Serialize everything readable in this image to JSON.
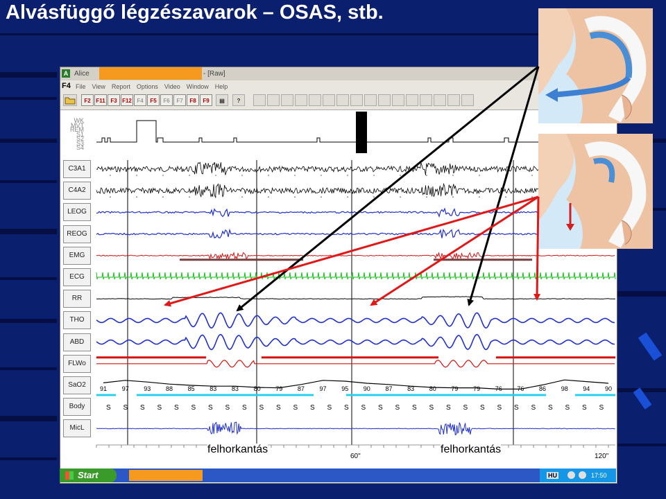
{
  "slide": {
    "title": "Alvásfüggő légzészavarok – OSAS, stb."
  },
  "window": {
    "app_name": "Alice",
    "mode": "- [Raw]",
    "f4_label": "F4",
    "menu": [
      "File",
      "View",
      "Report",
      "Options",
      "Video",
      "Window",
      "Help"
    ],
    "toolbar_keys": [
      {
        "label": "F2",
        "active": true
      },
      {
        "label": "F11",
        "active": true
      },
      {
        "label": "F3",
        "active": true
      },
      {
        "label": "F12",
        "active": true
      },
      {
        "label": "F4",
        "active": false
      },
      {
        "label": "F5",
        "active": true
      },
      {
        "label": "F6",
        "active": false
      },
      {
        "label": "F7",
        "active": false
      },
      {
        "label": "F8",
        "active": true
      },
      {
        "label": "F9",
        "active": true
      }
    ]
  },
  "hypnogram": {
    "stages": [
      "WK",
      "MVT",
      "REM",
      "S1",
      "S2",
      "S3",
      "S4"
    ]
  },
  "channels": [
    "C3A1",
    "C4A2",
    "LEOG",
    "REOG",
    "EMG",
    "ECG",
    "RR",
    "THO",
    "ABD",
    "FLWo",
    "SaO2",
    "Body",
    "MicL"
  ],
  "sao2_values": [
    "91",
    "97",
    "93",
    "88",
    "85",
    "83",
    "83",
    "80",
    "79",
    "87",
    "97",
    "95",
    "90",
    "87",
    "83",
    "80",
    "79",
    "79",
    "76",
    "76",
    "86",
    "98",
    "94",
    "90"
  ],
  "body_position": "S",
  "annotations": {
    "snore_1": "felhorkantás",
    "snore_2": "felhorkantás"
  },
  "time_marks": [
    "60\"",
    "120\""
  ],
  "taskbar": {
    "start_label": "Start",
    "language": "HU",
    "clock": "17:50"
  },
  "colors": {
    "eeg": "#000000",
    "eog": "#1f2fd0",
    "emg": "#d81010",
    "ecg": "#12c012",
    "resp": "#1f2fd0",
    "flow": "#d81010",
    "sat_bar": "#28d0f0",
    "pointer_black": "#000000",
    "pointer_red": "#e01818"
  }
}
